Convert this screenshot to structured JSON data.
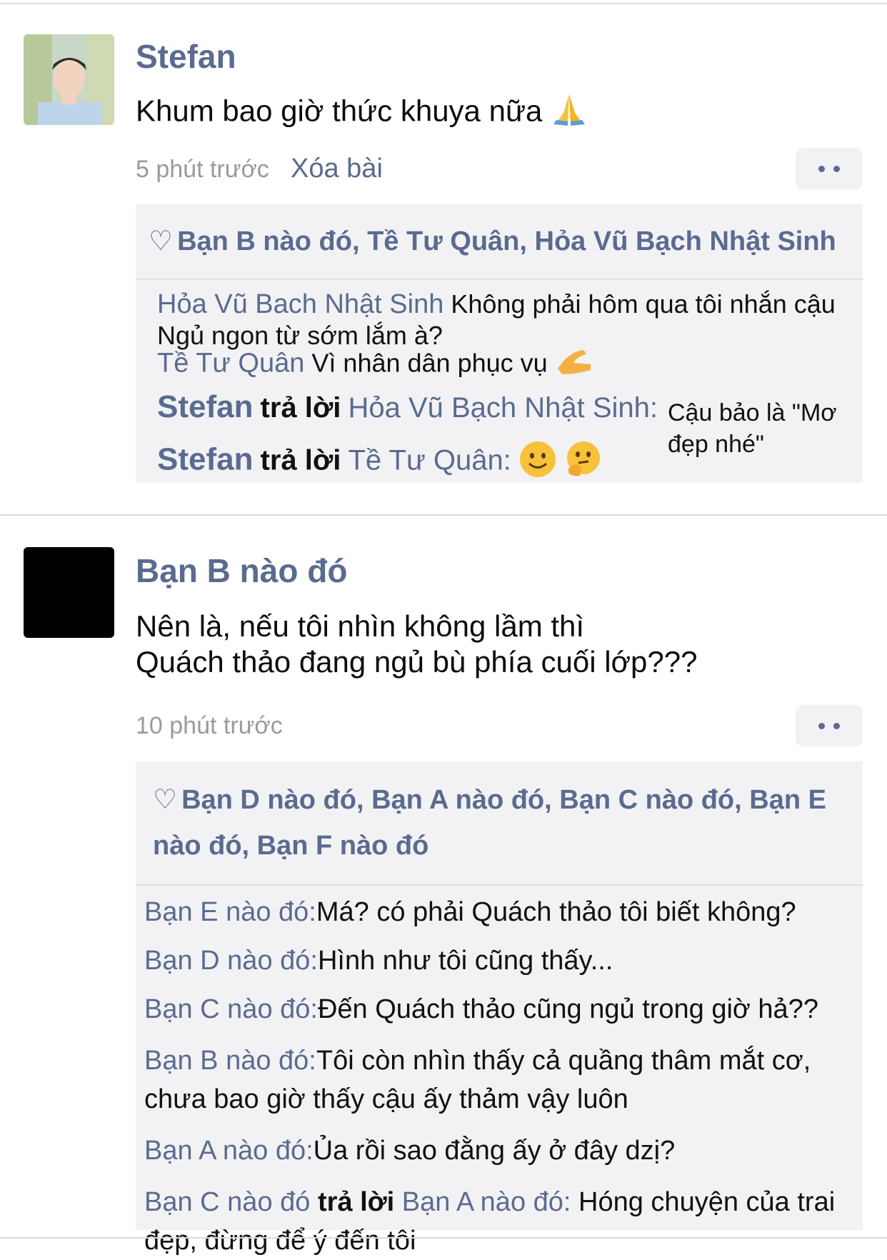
{
  "posts": [
    {
      "author": "Stefan",
      "text": "Khum bao giờ thức khuya nữa",
      "emoji": "pray-emoji",
      "time": "5 phút trước",
      "delete_label": "Xóa bài",
      "likes": "Bạn B nào đó, Tề Tư Quân, Hỏa Vũ Bạch Nhật Sinh",
      "comments": {
        "c1_name": "Hỏa Vũ Bach Nhật Sinh",
        "c1_text": "Không phải hôm qua tôi nhắn cậu Ngủ ngon từ sớm lắm à?",
        "c2_name": "Tề Tư Quân",
        "c2_text": "Vì nhân dân phục vụ",
        "c3_name": "Stefan",
        "c3_reply": "trả lời",
        "c3_target": "Hỏa Vũ Bạch Nhật Sinh:",
        "c3_text": "Cậu bảo là \"Mơ đẹp nhé\"",
        "c4_name": "Stefan",
        "c4_reply": "trả lời",
        "c4_target": "Tề Tư Quân:"
      }
    },
    {
      "author": "Bạn B nào đó",
      "text_line1": "Nên là, nếu tôi nhìn không lầm thì",
      "text_line2": "Quách thảo đang ngủ bù phía cuối lớp???",
      "time": "10 phút trước",
      "likes": "Bạn D nào đó, Bạn A nào đó, Bạn C nào đó, Bạn E nào đó, Bạn F nào đó",
      "comments": [
        {
          "name": "Bạn E nào đó:",
          "text": "Má? có phải Quách thảo tôi biết không?"
        },
        {
          "name": "Bạn D nào đó:",
          "text": "Hình như tôi cũng thấy..."
        },
        {
          "name": "Bạn C nào đó:",
          "text": "Đến Quách thảo cũng ngủ trong giờ hả??"
        },
        {
          "name": "Bạn B nào đó:",
          "text": "Tôi còn nhìn thấy cả quầng thâm mắt cơ, chưa bao giờ thấy cậu ấy thảm vậy luôn"
        },
        {
          "name": "Bạn A nào đó:",
          "text": "Ủa rồi sao đằng ấy ở đây dzị?"
        }
      ],
      "last_comment": {
        "name": "Bạn C nào đó",
        "reply": "trả lời",
        "target": "Bạn A nào đó:",
        "text": "Hóng chuyện của trai đẹp, đừng để ý đến tôi"
      }
    }
  ],
  "colors": {
    "accent": "#5b6b8f",
    "panel": "#f2f2f5",
    "muted": "#9a9a9a"
  }
}
